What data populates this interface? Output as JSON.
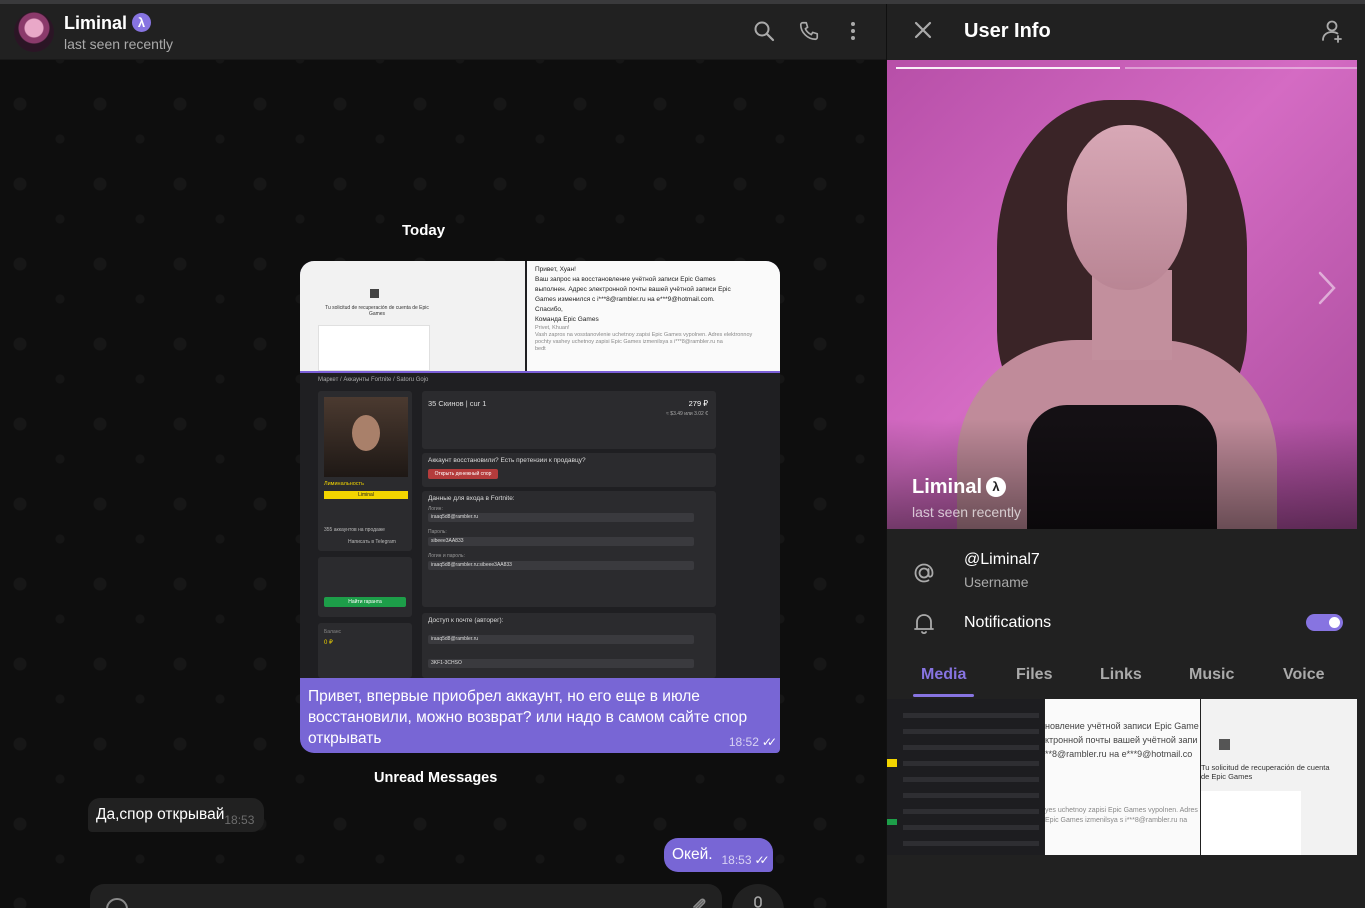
{
  "chat": {
    "name": "Liminal",
    "verified_glyph": "λ",
    "status": "last seen recently",
    "icons": [
      "search-icon",
      "phone-icon",
      "more-vertical-icon"
    ],
    "date_separator": "Today",
    "unread_separator": "Unread Messages",
    "messages": [
      {
        "direction": "out",
        "text": "Привет, впервые приобрел аккаунт, но его еще в июле восстановили, можно возврат? или надо в самом сайте спор открывать",
        "time": "18:52",
        "read": true,
        "screenshot": {
          "left_title": "Tu solicitud de recuperación de cuenta de Epic Games",
          "right_lines": [
            "Привет, Хуан!",
            "Ваш запрос на восстановление учётной записи Epic Games",
            "выполнен. Адрес электронной почты вашей учётной записи Epic",
            "Games изменился с i***8@rambler.ru на e***9@hotmail.com.",
            "Спасибо,",
            "Команда Epic Games"
          ],
          "right_lines_small": [
            "Privet, Khuan!",
            "Vash zapros na vosstanovlenie uchetnoy zapisi Epic Games vypolnen. Adres elektronnoy",
            "pochty vashey uchetnoy zapisi Epic Games izmenilsya s i***8@rambler.ru na",
            "bedt"
          ],
          "breadcrumb": "Маркет / Аккаунты Fortnite / Satoru Gojo",
          "item_title": "35 Скинов | cur 1",
          "item_price": "279 ₽",
          "item_price_alt": "≈ $3.49 или 3.02 €",
          "seller_badge": "Liminal",
          "seller_name": "Лиминальность",
          "sold_line": "355 аккаунтов на продаже",
          "telegram_button": "Написать в Telegram",
          "warranty_button": "Найти гаранта",
          "block_restored": "Аккаунт восстановили? Есть претензии к продавцу?",
          "block_restored_button": "Открыть денежный спор",
          "block_login": "Данные для входа в Fortnite:",
          "field_login_label": "Логин:",
          "field_login": "iraaq5d8@rambler.ru",
          "field_pass_label": "Пароль:",
          "field_pass": "sibeee3AA833",
          "field_combo_label": "Логин и пароль:",
          "field_combo": "iraaq5d8@rambler.ru:sibeee3AA833",
          "block_email": "Доступ к почте (авторег):",
          "field_email": "iraaq5d8@rambler.ru",
          "field_email_pass": "3KF1-3CHSO",
          "balance_label": "Баланс",
          "balance_value": "0 ₽"
        }
      },
      {
        "direction": "in",
        "text": "Да,спор открывай",
        "time": "18:53"
      },
      {
        "direction": "out",
        "text": "Окей.",
        "time": "18:53",
        "read": true
      }
    ],
    "composer": {
      "placeholder": "",
      "icons": [
        "smile-icon",
        "paperclip-icon",
        "microphone-icon"
      ]
    }
  },
  "user_info": {
    "title": "User Info",
    "name": "Liminal",
    "status": "last seen recently",
    "username": "@Liminal7",
    "username_label": "Username",
    "notifications_label": "Notifications",
    "notifications_on": true,
    "photo_index": 1,
    "photo_count": 2,
    "tabs": [
      "Media",
      "Files",
      "Links",
      "Music",
      "Voice"
    ],
    "active_tab": "Media",
    "media_thumb_lines": [
      "новление учётной записи Epic Game",
      "ктронной почты вашей учётной запи",
      "**8@rambler.ru на e***9@hotmail.co",
      "yes uchetnoy zapisi Epic Games vypolnen. Adres",
      "Epic Games izmenilsya s i***8@rambler.ru na"
    ],
    "media_thumb_spanish": [
      "Tu solicitud de recuperación de cuenta",
      "de Epic Games"
    ],
    "colors": {
      "accent": "#8774e1",
      "bubble_out": "#7866d5",
      "panel": "#212121"
    }
  }
}
